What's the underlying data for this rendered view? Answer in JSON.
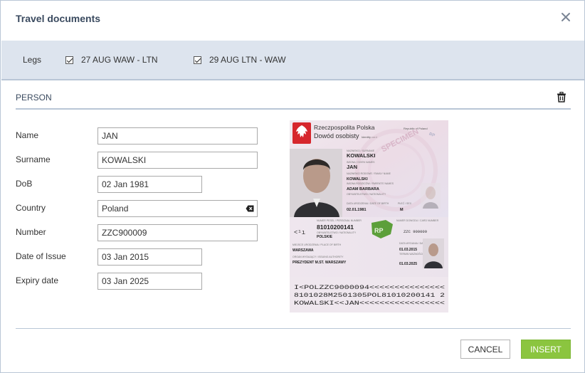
{
  "dialog": {
    "title": "Travel documents"
  },
  "legs": {
    "label": "Legs",
    "items": [
      {
        "label": "27 AUG WAW - LTN",
        "checked": true
      },
      {
        "label": "29 AUG LTN - WAW",
        "checked": true
      }
    ]
  },
  "person": {
    "section_label": "PERSON",
    "fields": {
      "name": {
        "label": "Name",
        "value": "JAN"
      },
      "surname": {
        "label": "Surname",
        "value": "KOWALSKI"
      },
      "dob": {
        "label": "DoB",
        "value": "02 Jan 1981"
      },
      "country": {
        "label": "Country",
        "value": "Poland"
      },
      "number": {
        "label": "Number",
        "value": "ZZC900009"
      },
      "date_of_issue": {
        "label": "Date of Issue",
        "value": "03 Jan 2015"
      },
      "expiry_date": {
        "label": "Expiry date",
        "value": "03 Jan 2025"
      }
    }
  },
  "id_card": {
    "header1": "Rzeczpospolita Polska",
    "header1_small": "Republic of Poland",
    "header2": "Dowód osobisty",
    "header2_small": "Identity card",
    "watermark": "SPECIMEN",
    "front_surname": "KOWALSKI",
    "front_name": "JAN",
    "front_family": "KOWALSKI",
    "front_parents": "ADAM BARBARA",
    "front_dob": "02.01.1981",
    "front_sex": "M",
    "back_pesel": "81010200141",
    "back_citizenship": "POLSKIE",
    "back_docnum": "ZZC 900009",
    "back_place": "WARSZAWA",
    "back_issue": "01.03.2015",
    "back_expiry": "01.03.2025",
    "back_authority": "PREZYDENT M.ST. WARSZAWY",
    "mrz1": "I<POLZZC9000094<<<<<<<<<<<<<<<",
    "mrz2": "8101028M2501305POL81010200141 2",
    "mrz3": "KOWALSKI<<JAN<<<<<<<<<<<<<<<<<"
  },
  "actions": {
    "cancel": "CANCEL",
    "insert": "INSERT"
  },
  "colors": {
    "accent_green": "#8bc53f",
    "legs_bg": "#dde4ee",
    "title": "#3a4a5f"
  }
}
